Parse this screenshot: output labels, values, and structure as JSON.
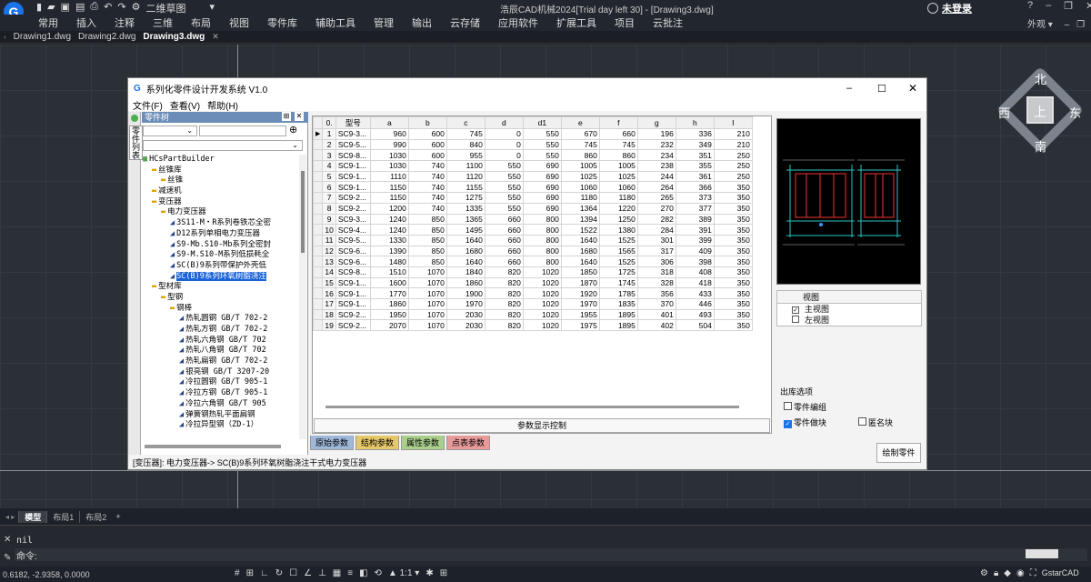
{
  "app": {
    "title": "浩辰CAD机械2024[Trial day left 30] - [Drawing3.dwg]",
    "workspace": "二维草图",
    "login": "未登录",
    "appearance": "外观",
    "brand_color": "#1a73e8"
  },
  "menu": [
    "常用",
    "插入",
    "注释",
    "三维",
    "布局",
    "视图",
    "零件库",
    "辅助工具",
    "管理",
    "输出",
    "云存储",
    "应用软件",
    "扩展工具",
    "项目",
    "云批注"
  ],
  "doc_tabs": [
    "Drawing1.dwg",
    "Drawing2.dwg",
    "Drawing3.dwg"
  ],
  "compass": {
    "n": "北",
    "s": "南",
    "e": "东",
    "w": "西",
    "top": "上"
  },
  "dialog": {
    "title": "系列化零件设计开发系统 V1.0",
    "menu": [
      "文件(F)",
      "查看(V)",
      "帮助(H)"
    ],
    "tree_title": "零件树",
    "side_tab": "零件列表",
    "tree": [
      {
        "label": "HCsPartBuilder",
        "level": 0,
        "sel": false
      },
      {
        "label": "丝锥库",
        "level": 1,
        "sel": false
      },
      {
        "label": "丝锥",
        "level": 2,
        "sel": false
      },
      {
        "label": "减速机",
        "level": 1,
        "sel": false
      },
      {
        "label": "变压器",
        "level": 1,
        "sel": false
      },
      {
        "label": "电力变压器",
        "level": 2,
        "sel": false
      },
      {
        "label": "3S11-M・R系列卷铁芯全密",
        "level": 3,
        "sel": false
      },
      {
        "label": "D12系列单相电力变压器",
        "level": 3,
        "sel": false
      },
      {
        "label": "S9-Mb.S10-Mb系列全密封",
        "level": 3,
        "sel": false
      },
      {
        "label": "S9-M.S10-M系列低损耗全",
        "level": 3,
        "sel": false
      },
      {
        "label": "SC(B)9系列带保护外壳低",
        "level": 3,
        "sel": false
      },
      {
        "label": "SC(B)9系列环氧树脂浇注",
        "level": 3,
        "sel": true
      },
      {
        "label": "型材库",
        "level": 1,
        "sel": false
      },
      {
        "label": "型钢",
        "level": 2,
        "sel": false
      },
      {
        "label": "钢棒",
        "level": 3,
        "sel": false
      },
      {
        "label": "热轧圆钢 GB/T 702-2",
        "level": 4,
        "sel": false
      },
      {
        "label": "热轧方钢 GB/T 702-2",
        "level": 4,
        "sel": false
      },
      {
        "label": "热轧六角钢 GB/T 702",
        "level": 4,
        "sel": false
      },
      {
        "label": "热轧八角钢 GB/T 702",
        "level": 4,
        "sel": false
      },
      {
        "label": "热轧扁钢 GB/T 702-2",
        "level": 4,
        "sel": false
      },
      {
        "label": "银亮钢 GB/T 3207-20",
        "level": 4,
        "sel": false
      },
      {
        "label": "冷拉圆钢 GB/T 905-1",
        "level": 4,
        "sel": false
      },
      {
        "label": "冷拉方钢 GB/T 905-1",
        "level": 4,
        "sel": false
      },
      {
        "label": "冷拉六角钢 GB/T 905",
        "level": 4,
        "sel": false
      },
      {
        "label": "弹簧钢热轧平面扁钢",
        "level": 4,
        "sel": false
      },
      {
        "label": "冷拉异型钢（ZD-1）",
        "level": 4,
        "sel": false
      }
    ],
    "grid": {
      "headers": [
        "0.",
        "型号",
        "a",
        "b",
        "c",
        "d",
        "d1",
        "e",
        "f",
        "g",
        "h",
        "I"
      ],
      "rows": [
        [
          "1",
          "SC9-3...",
          "960",
          "600",
          "745",
          "0",
          "550",
          "670",
          "660",
          "196",
          "336",
          "210"
        ],
        [
          "2",
          "SC9-5...",
          "990",
          "600",
          "840",
          "0",
          "550",
          "745",
          "745",
          "232",
          "349",
          "210"
        ],
        [
          "3",
          "SC9-8...",
          "1030",
          "600",
          "955",
          "0",
          "550",
          "860",
          "860",
          "234",
          "351",
          "250"
        ],
        [
          "4",
          "SC9-1...",
          "1030",
          "740",
          "1100",
          "550",
          "690",
          "1005",
          "1005",
          "238",
          "355",
          "250"
        ],
        [
          "5",
          "SC9-1...",
          "1110",
          "740",
          "1120",
          "550",
          "690",
          "1025",
          "1025",
          "244",
          "361",
          "250"
        ],
        [
          "6",
          "SC9-1...",
          "1150",
          "740",
          "1155",
          "550",
          "690",
          "1060",
          "1060",
          "264",
          "366",
          "350"
        ],
        [
          "7",
          "SC9-2...",
          "1150",
          "740",
          "1275",
          "550",
          "690",
          "1180",
          "1180",
          "265",
          "373",
          "350"
        ],
        [
          "8",
          "SC9-2...",
          "1200",
          "740",
          "1335",
          "550",
          "690",
          "1364",
          "1220",
          "270",
          "377",
          "350"
        ],
        [
          "9",
          "SC9-3...",
          "1240",
          "850",
          "1365",
          "660",
          "800",
          "1394",
          "1250",
          "282",
          "389",
          "350"
        ],
        [
          "10",
          "SC9-4...",
          "1240",
          "850",
          "1495",
          "660",
          "800",
          "1522",
          "1380",
          "284",
          "391",
          "350"
        ],
        [
          "11",
          "SC9-5...",
          "1330",
          "850",
          "1640",
          "660",
          "800",
          "1640",
          "1525",
          "301",
          "399",
          "350"
        ],
        [
          "12",
          "SC9-6...",
          "1390",
          "850",
          "1680",
          "660",
          "800",
          "1680",
          "1565",
          "317",
          "409",
          "350"
        ],
        [
          "13",
          "SC9-6...",
          "1480",
          "850",
          "1640",
          "660",
          "800",
          "1640",
          "1525",
          "306",
          "398",
          "350"
        ],
        [
          "14",
          "SC9-8...",
          "1510",
          "1070",
          "1840",
          "820",
          "1020",
          "1850",
          "1725",
          "318",
          "408",
          "350"
        ],
        [
          "15",
          "SC9-1...",
          "1600",
          "1070",
          "1860",
          "820",
          "1020",
          "1870",
          "1745",
          "328",
          "418",
          "350"
        ],
        [
          "16",
          "SC9-1...",
          "1770",
          "1070",
          "1900",
          "820",
          "1020",
          "1920",
          "1785",
          "356",
          "433",
          "350"
        ],
        [
          "17",
          "SC9-1...",
          "1860",
          "1070",
          "1970",
          "820",
          "1020",
          "1970",
          "1835",
          "370",
          "446",
          "350"
        ],
        [
          "18",
          "SC9-2...",
          "1950",
          "1070",
          "2030",
          "820",
          "1020",
          "1955",
          "1895",
          "401",
          "493",
          "350"
        ],
        [
          "19",
          "SC9-2...",
          "2070",
          "1070",
          "2030",
          "820",
          "1020",
          "1975",
          "1895",
          "402",
          "504",
          "350"
        ]
      ]
    },
    "param_button": "参数显示控制",
    "param_tabs": [
      {
        "label": "原始参数",
        "color": "#9fb8d8"
      },
      {
        "label": "结构参数",
        "color": "#e6c86a"
      },
      {
        "label": "属性参数",
        "color": "#a9cf8a"
      },
      {
        "label": "点表参数",
        "color": "#e69a9a"
      }
    ],
    "view_table": {
      "header": "视图",
      "rows": [
        {
          "label": "主视图",
          "checked": true
        },
        {
          "label": "左视图",
          "checked": false
        }
      ]
    },
    "options": {
      "title": "出库选项",
      "items": [
        {
          "label": "零件编组",
          "checked": false
        },
        {
          "label": "零件做块",
          "checked": true
        },
        {
          "label": "匿名块",
          "checked": false
        }
      ]
    },
    "draw_button": "绘制零件",
    "status": "[变压器]: 电力变压器-> SC(B)9系列环氧树脂浇注干式电力变压器"
  },
  "layout_tabs": [
    "模型",
    "布局1",
    "布局2"
  ],
  "command": {
    "history": "nil",
    "prompt": "命令:"
  },
  "coords": "0.6182, -2.9358, 0.0000",
  "brand": "GstarCAD"
}
